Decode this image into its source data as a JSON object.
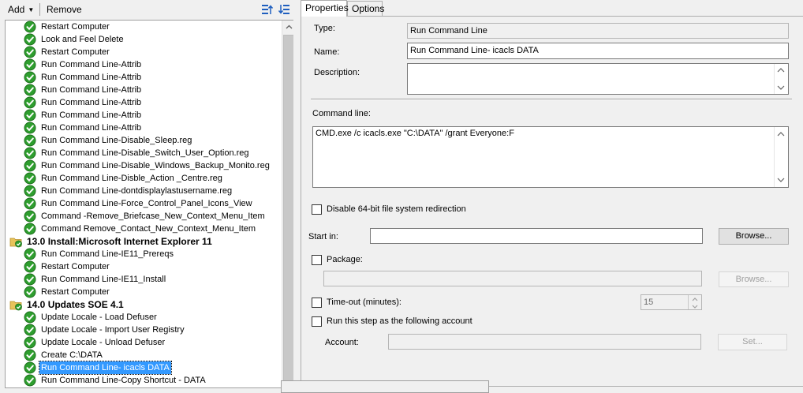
{
  "toolbar": {
    "add_label": "Add",
    "remove_label": "Remove"
  },
  "tree": {
    "items": [
      {
        "kind": "step",
        "label": "Restart Computer"
      },
      {
        "kind": "step",
        "label": "Look and Feel Delete"
      },
      {
        "kind": "step",
        "label": "Restart Computer"
      },
      {
        "kind": "step",
        "label": "Run Command Line-Attrib"
      },
      {
        "kind": "step",
        "label": "Run Command Line-Attrib"
      },
      {
        "kind": "step",
        "label": "Run Command Line-Attrib"
      },
      {
        "kind": "step",
        "label": "Run Command Line-Attrib"
      },
      {
        "kind": "step",
        "label": "Run Command Line-Attrib"
      },
      {
        "kind": "step",
        "label": "Run Command Line-Attrib"
      },
      {
        "kind": "step",
        "label": "Run Command Line-Disable_Sleep.reg"
      },
      {
        "kind": "step",
        "label": "Run Command Line-Disable_Switch_User_Option.reg"
      },
      {
        "kind": "step",
        "label": "Run Command Line-Disable_Windows_Backup_Monito.reg"
      },
      {
        "kind": "step",
        "label": "Run Command Line-Disble_Action _Centre.reg"
      },
      {
        "kind": "step",
        "label": "Run Command Line-dontdisplaylastusername.reg"
      },
      {
        "kind": "step",
        "label": "Run Command Line-Force_Control_Panel_Icons_View"
      },
      {
        "kind": "step",
        "label": "Command -Remove_Briefcase_New_Context_Menu_Item"
      },
      {
        "kind": "step",
        "label": "Command Remove_Contact_New_Context_Menu_Item"
      },
      {
        "kind": "group",
        "label": "13.0 Install:Microsoft Internet Explorer 11"
      },
      {
        "kind": "step",
        "label": "Run Command Line-IE11_Prereqs"
      },
      {
        "kind": "step",
        "label": "Restart Computer"
      },
      {
        "kind": "step",
        "label": "Run Command Line-IE11_Install"
      },
      {
        "kind": "step",
        "label": "Restart Computer"
      },
      {
        "kind": "group",
        "label": "14.0 Updates SOE 4.1"
      },
      {
        "kind": "step",
        "label": "Update Locale - Load Defuser"
      },
      {
        "kind": "step",
        "label": "Update Locale - Import User Registry"
      },
      {
        "kind": "step",
        "label": "Update Locale - Unload Defuser"
      },
      {
        "kind": "step",
        "label": "Create C:\\DATA"
      },
      {
        "kind": "step",
        "label": "Run Command Line- icacls DATA",
        "selected": true
      },
      {
        "kind": "step",
        "label": "Run Command Line-Copy Shortcut - DATA"
      }
    ]
  },
  "tabs": {
    "properties": "Properties",
    "options": "Options"
  },
  "properties": {
    "type_label": "Type:",
    "type_value": "Run Command Line",
    "name_label": "Name:",
    "name_value": "Run Command Line- icacls DATA",
    "description_label": "Description:",
    "description_value": "",
    "command_line_label": "Command line:",
    "command_line_value": "CMD.exe /c icacls.exe \"C:\\DATA\" /grant Everyone:F",
    "disable64_label": "Disable 64-bit file system redirection",
    "start_in_label": "Start in:",
    "start_in_value": "",
    "browse_label": "Browse...",
    "package_label": "Package:",
    "package_value": "",
    "package_browse_label": "Browse...",
    "timeout_label": "Time-out (minutes):",
    "timeout_value": "15",
    "run_as_label": "Run this step as the following account",
    "account_label": "Account:",
    "account_value": "",
    "set_label": "Set..."
  },
  "colors": {
    "selection": "#3399ff",
    "check_green": "#2e9e2e",
    "folder": "#e8c35a"
  }
}
